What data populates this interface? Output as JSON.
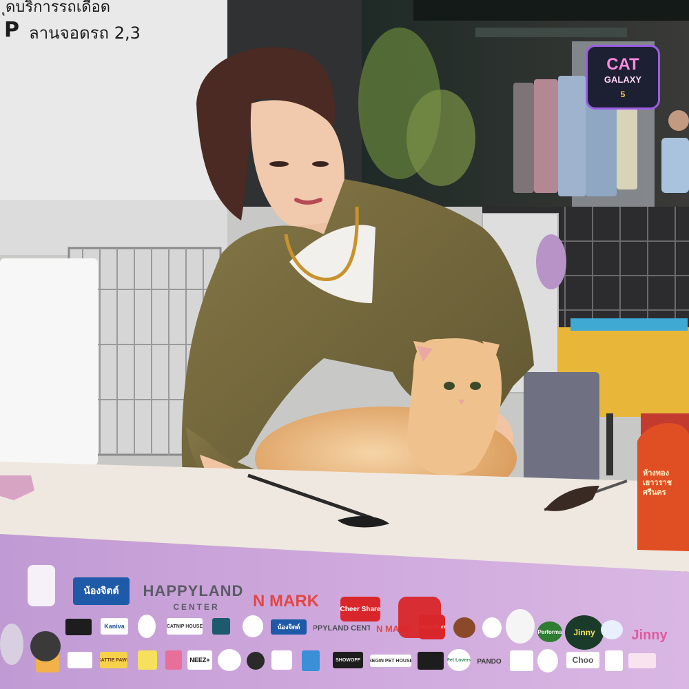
{
  "sign": {
    "line1": "ุดบริการรถเดือด",
    "parking_letter": "P",
    "line2": "ลานจอดรถ 2,3"
  },
  "event_logo": {
    "line1": "CAT",
    "line2": "GALAXY",
    "number": "5"
  },
  "tag": {
    "text": "ห้างทอง\nเยาวราชศรีนคร"
  },
  "banner": {
    "sponsors_row1": [
      "น้องจิตต์",
      "HAPPYLAND",
      "N MARK",
      "Cheer Share",
      "Jinny",
      "Performa",
      "Jinny"
    ],
    "happyland_center": "CENTER",
    "sponsors_row2": [
      "Kaniva",
      "CATNIP HOUSE",
      "น้องจิตต์",
      "HAPPYLAND CENTER",
      "N MARK",
      "Cheer Share"
    ],
    "sponsors_row3": [
      "CATTIE PAWS",
      "NEEZ+",
      "SHOWOFF",
      "BEGIN PET HOUSE",
      "Pet Lovers",
      "PANDO",
      "Choo"
    ]
  },
  "colors": {
    "banner": "#c69bd8",
    "shirt": "#7a6e3c",
    "cat": "#e8b27a",
    "table": "#efe8e0"
  }
}
